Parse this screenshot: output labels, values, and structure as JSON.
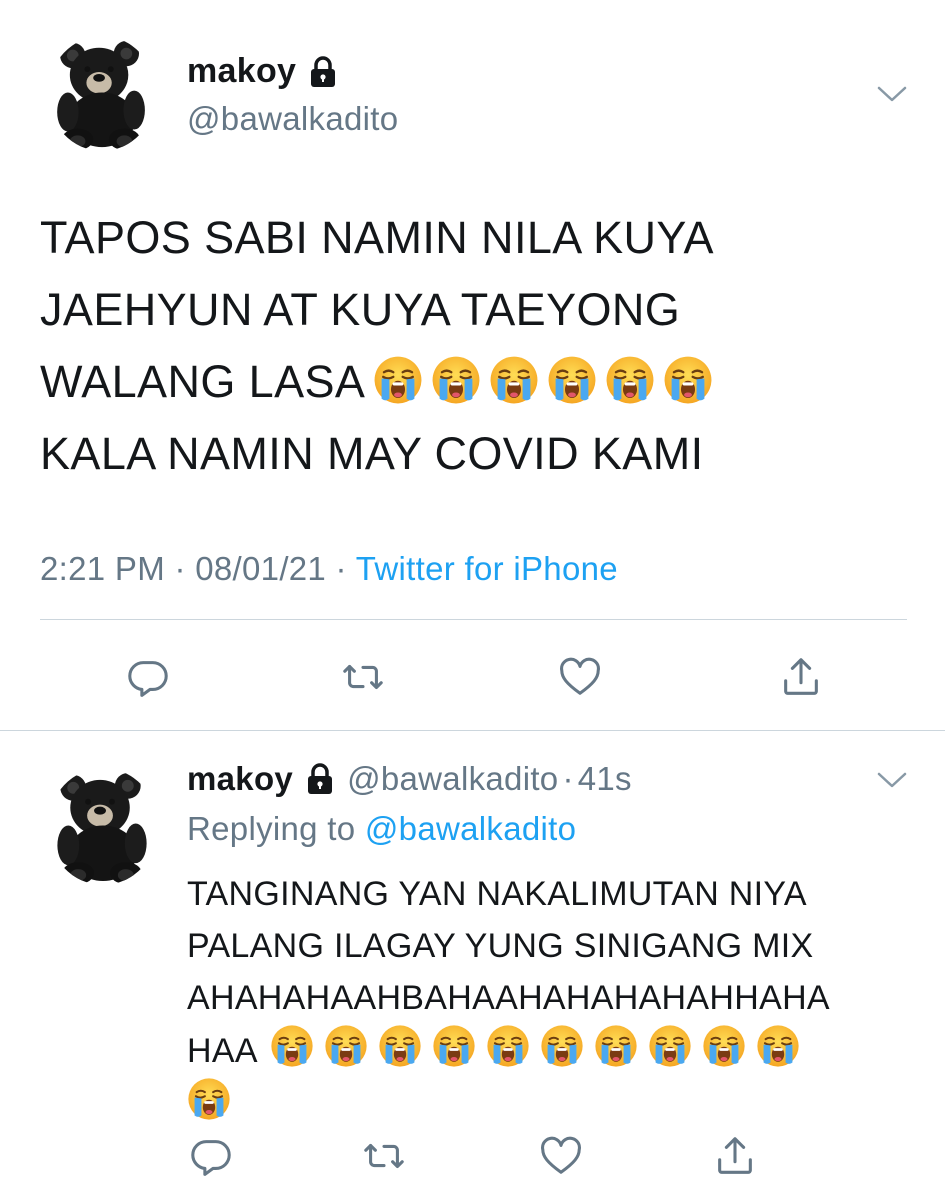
{
  "main_tweet": {
    "name": "makoy",
    "handle": "@bawalkadito",
    "text_lines": [
      "TAPOS SABI NAMIN NILA KUYA",
      "JAEHYUN AT KUYA TAEYONG",
      "WALANG LASA",
      "KALA NAMIN MAY COVID KAMI"
    ],
    "emoji_after_line3": [
      "loudly-crying-face",
      "loudly-crying-face",
      "loudly-crying-face",
      "loudly-crying-face",
      "loudly-crying-face",
      "loudly-crying-face"
    ],
    "time": "2:21 PM",
    "date": "08/01/21",
    "separator": " · ",
    "source": "Twitter for iPhone"
  },
  "reply_tweet": {
    "name": "makoy",
    "handle": "@bawalkadito",
    "dot": "·",
    "time_ago": "41s",
    "replying_prefix": "Replying to ",
    "replying_to": "@bawalkadito",
    "text_lines": [
      "TANGINANG YAN NAKALIMUTAN NIYA",
      "PALANG ILAGAY YUNG SINIGANG MIX",
      "AHAHAHAAHBAHAAHAHAHAHAHHAHA",
      "HAA"
    ],
    "emoji_count_line4": 10,
    "emoji_count_line5": 1
  },
  "icons": {
    "reply": "speech-bubble-icon",
    "retweet": "retweet-icon",
    "like": "heart-icon",
    "share": "share-icon",
    "lock": "lock-icon",
    "chevron": "chevron-down-icon",
    "emoji": "loudly-crying-face"
  },
  "colors": {
    "text": "#14171a",
    "secondary": "#657786",
    "link": "#1da1f2",
    "divider": "#ccd6dd",
    "icon": "#657786"
  }
}
